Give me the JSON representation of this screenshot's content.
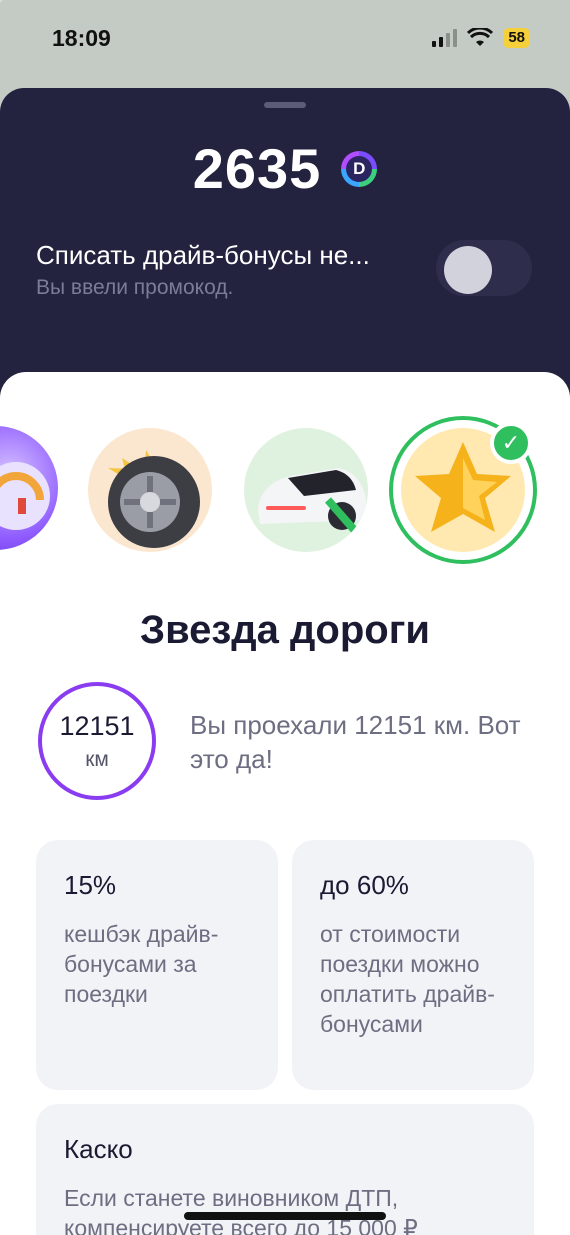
{
  "status": {
    "time": "18:09",
    "battery": "58"
  },
  "balance": {
    "value": "2635",
    "coin_symbol": "D"
  },
  "bonus_toggle": {
    "title": "Списать драйв-бонусы не...",
    "subtitle": "Вы ввели промокод.",
    "enabled": false
  },
  "level": {
    "title": "Звезда дороги",
    "distance_value": "12151",
    "distance_unit": "км",
    "distance_text": "Вы проехали 12151 км. Вот это да!"
  },
  "cards": [
    {
      "title": "15%",
      "text": "кешбэк драйв-бонусами за поездки"
    },
    {
      "title": "до 60%",
      "text": "от стоимости поездки можно оплатить драйв-бонусами"
    },
    {
      "title": "Каско",
      "text": "Если станете виновником ДТП, компенсируете всего до 15 000 ₽"
    }
  ],
  "badges": [
    {
      "icon": "speedometer-icon"
    },
    {
      "icon": "tire-icon"
    },
    {
      "icon": "car-icon"
    },
    {
      "icon": "star-icon",
      "selected": true
    }
  ],
  "colors": {
    "dark_sheet": "#23223f",
    "accent_purple": "#8a3df0",
    "accent_green": "#2fbf5e"
  }
}
